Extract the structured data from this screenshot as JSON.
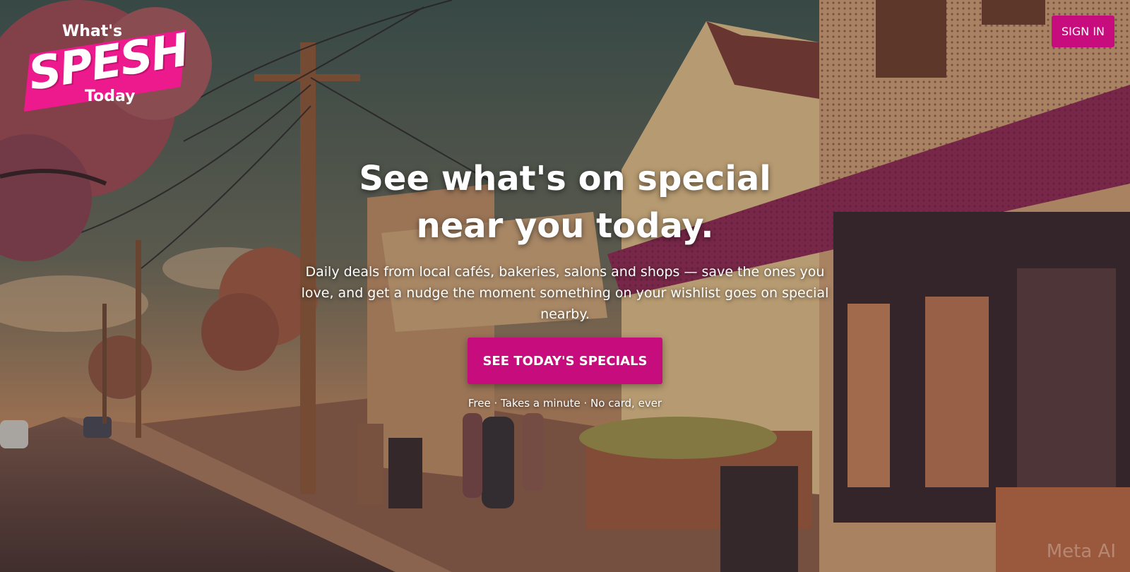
{
  "header": {
    "logo": {
      "line1": "What's",
      "word": "SPESH",
      "line2": "Today"
    },
    "signin_label": "SIGN IN"
  },
  "hero": {
    "headline": "See what's on special near you today.",
    "subtext": "Daily deals from local cafés, bakeries, salons and shops — save the ones you love, and get a nudge the moment something on your wishlist goes on special nearby.",
    "cta_label": "SEE TODAY'S SPECIALS",
    "note": "Free · Takes a minute · No card, ever"
  },
  "watermark": "Meta AI",
  "colors": {
    "brand_pink": "#c70c7d",
    "logo_pink": "#ec1a8c",
    "sky": "#46574f"
  }
}
